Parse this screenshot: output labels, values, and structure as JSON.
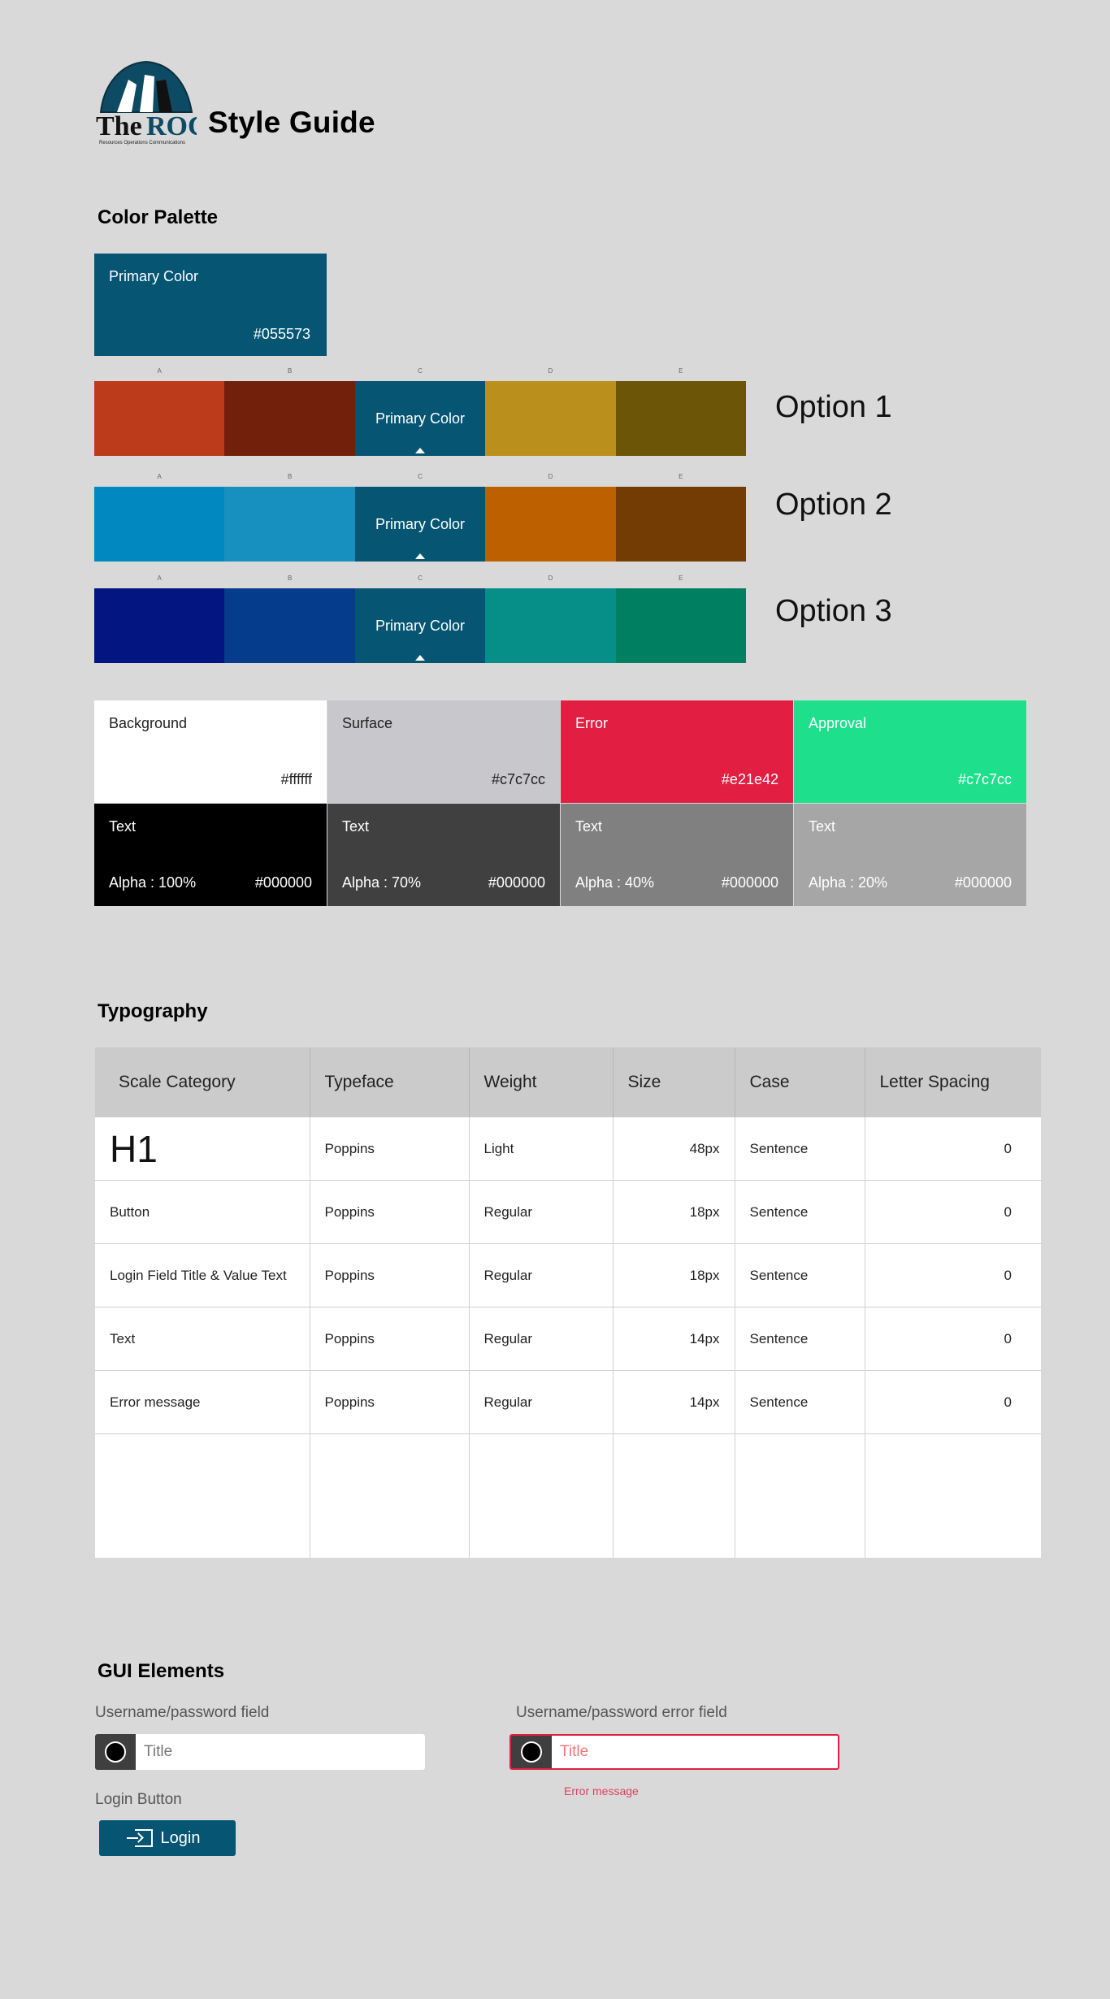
{
  "header": {
    "logo_text": "The ROC",
    "logo_subtext": "Resources Operations Communications",
    "title": "Style Guide"
  },
  "color_palette": {
    "section_title": "Color Palette",
    "primary": {
      "label": "Primary Color",
      "hex": "#055573",
      "color": "#055573"
    },
    "letters": [
      "A",
      "B",
      "C",
      "D",
      "E"
    ],
    "options": [
      {
        "label": "Option 1",
        "swatches": [
          "#bc3b1a",
          "#72200c",
          "#055573",
          "#bb8f1c",
          "#6d5508"
        ],
        "primary_label": "Primary Color"
      },
      {
        "label": "Option 2",
        "swatches": [
          "#0288c0",
          "#1890bf",
          "#055573",
          "#bd6000",
          "#723c04"
        ],
        "primary_label": "Primary Color"
      },
      {
        "label": "Option 3",
        "swatches": [
          "#021580",
          "#053d8c",
          "#055573",
          "#058f88",
          "#008060"
        ],
        "primary_label": "Primary Color"
      }
    ],
    "tokens": [
      {
        "name": "Background",
        "hex": "#ffffff",
        "bg": "#ffffff",
        "fg": "#222222"
      },
      {
        "name": "Surface",
        "hex": "#c7c7cc",
        "bg": "#c7c7cc",
        "fg": "#222222"
      },
      {
        "name": "Error",
        "hex": "#e21e42",
        "bg": "#e21e42",
        "fg": "#ffffff"
      },
      {
        "name": "Approval",
        "hex": "#c7c7cc",
        "bg": "#1ee08c",
        "fg": "#ffffff"
      }
    ],
    "text_tokens": [
      {
        "name": "Text",
        "alpha": "Alpha : 100%",
        "hex": "#000000",
        "bg": "#000000"
      },
      {
        "name": "Text",
        "alpha": "Alpha : 70%",
        "hex": "#000000",
        "bg": "#404040"
      },
      {
        "name": "Text",
        "alpha": "Alpha : 40%",
        "hex": "#000000",
        "bg": "#808080"
      },
      {
        "name": "Text",
        "alpha": "Alpha : 20%",
        "hex": "#000000",
        "bg": "#a6a6a6"
      }
    ]
  },
  "typography": {
    "section_title": "Typography",
    "headers": [
      "Scale Category",
      "Typeface",
      "Weight",
      "Size",
      "Case",
      "Letter Spacing"
    ],
    "rows": [
      [
        "H1",
        "Poppins",
        "Light",
        "48px",
        "Sentence",
        "0"
      ],
      [
        "Button",
        "Poppins",
        "Regular",
        "18px",
        "Sentence",
        "0"
      ],
      [
        "Login Field Title & Value Text",
        "Poppins",
        "Regular",
        "18px",
        "Sentence",
        "0"
      ],
      [
        "Text",
        "Poppins",
        "Regular",
        "14px",
        "Sentence",
        "0"
      ],
      [
        "Error message",
        "Poppins",
        "Regular",
        "14px",
        "Sentence",
        "0"
      ]
    ]
  },
  "gui": {
    "section_title": "GUI Elements",
    "field_label": "Username/password field",
    "field_placeholder": "Title",
    "error_field_label": "Username/password error field",
    "error_field_placeholder": "Title",
    "error_message": "Error message",
    "login_label": "Login Button",
    "login_button": "Login"
  }
}
